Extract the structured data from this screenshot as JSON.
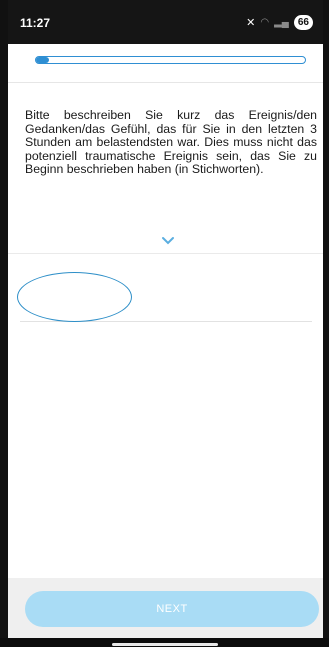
{
  "status_bar": {
    "time": "11:27",
    "battery": "66",
    "icons": [
      "mute-icon",
      "wifi-icon",
      "signal-icon"
    ]
  },
  "progress": {
    "value": 0.05,
    "color": "#2f8fd3"
  },
  "question": {
    "text": "Bitte beschreiben Sie kurz das Ereignis/den Gedanken/das Gefühl, das für Sie in den letzten 3 Stunden am belastendsten war. Dies muss nicht das potenziell traumatische Ereignis sein, das Sie zu Beginn beschrieben haben (in Stichworten)."
  },
  "answer": {
    "value": "",
    "placeholder": ""
  },
  "buttons": {
    "next_label": "NEXT",
    "next_color": "#a9dcf5"
  }
}
